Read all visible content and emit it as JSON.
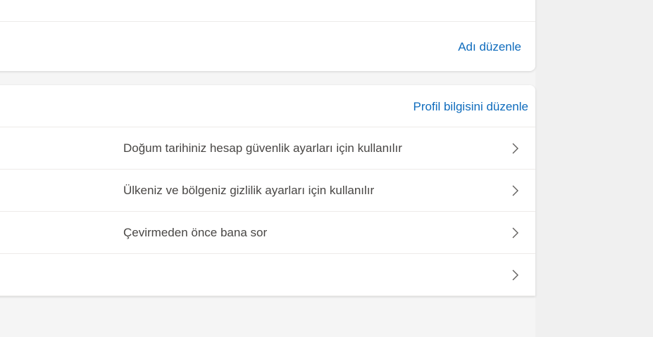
{
  "name_card": {
    "edit_name_link": "Adı düzenle"
  },
  "profile_card": {
    "edit_profile_link": "Profil bilgisini düzenle",
    "rows": [
      {
        "text": "Doğum tarihiniz hesap güvenlik ayarları için kullanılır",
        "icon": "chevron-right-icon"
      },
      {
        "text": "Ülkeniz ve bölgeniz gizlilik ayarları için kullanılır",
        "icon": "chevron-right-icon"
      },
      {
        "text": "Çevirmeden önce bana sor",
        "icon": "chevron-right-icon"
      },
      {
        "text": "",
        "icon": "chevron-right-icon"
      }
    ]
  },
  "colors": {
    "link": "#0f6cbd",
    "background": "#f5f5f5",
    "card": "#ffffff",
    "divider": "#edebe9"
  }
}
